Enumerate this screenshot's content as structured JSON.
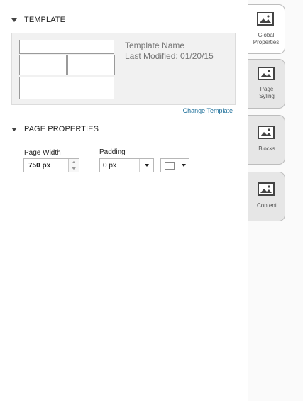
{
  "template_section": {
    "title": "TEMPLATE",
    "template_name": "Template Name",
    "last_modified": "Last Modified: 01/20/15",
    "change_link": "Change Template"
  },
  "page_properties": {
    "title": "PAGE PROPERTIES",
    "page_width": {
      "label": "Page Width",
      "value": "750 px"
    },
    "padding": {
      "label": "Padding",
      "value": "0 px"
    }
  },
  "tabs": [
    {
      "label_line1": "Global",
      "label_line2": "Properties",
      "icon": "image-icon",
      "active": true
    },
    {
      "label_line1": "Page",
      "label_line2": "Syling",
      "icon": "image-icon",
      "active": false
    },
    {
      "label_line1": "Blocks",
      "label_line2": "",
      "icon": "image-icon",
      "active": false
    },
    {
      "label_line1": "Content",
      "label_line2": "",
      "icon": "image-icon",
      "active": false
    }
  ],
  "colors": {
    "link": "#1d6f9a",
    "tab_active": "#ffffff",
    "tab_inactive": "#e6e6e6",
    "template_bg": "#f1f1f1"
  }
}
